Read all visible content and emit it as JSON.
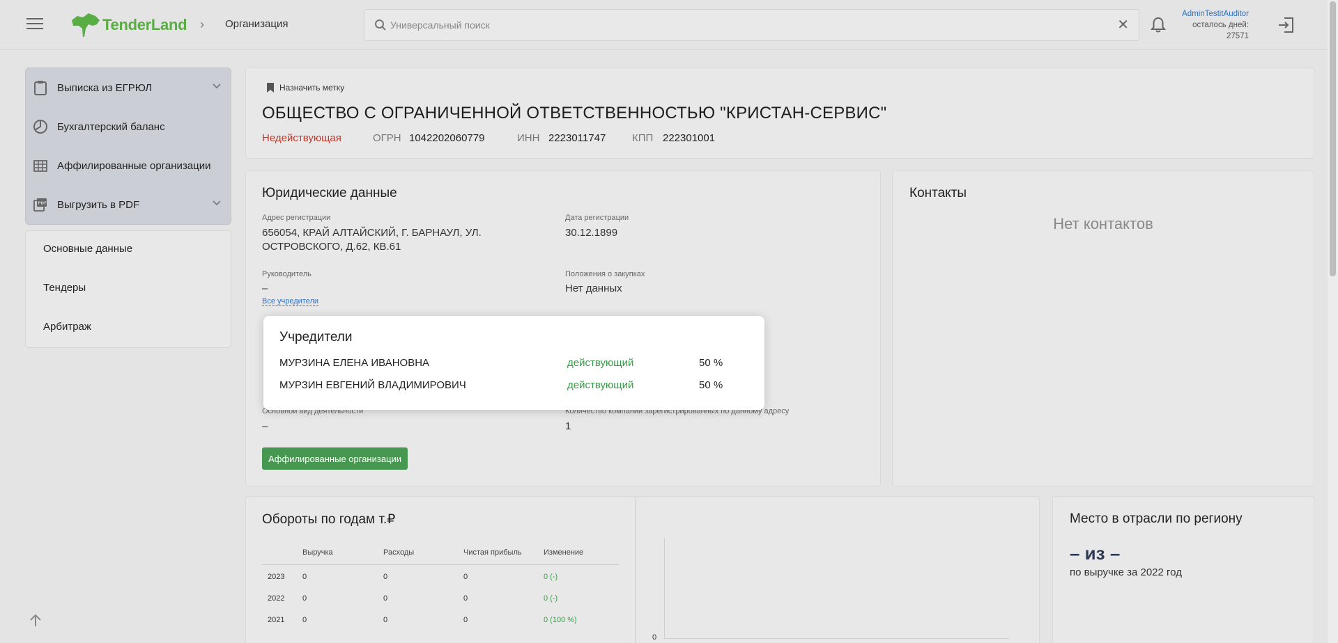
{
  "header": {
    "logo_text": "TenderLand",
    "breadcrumb_current": "Организация",
    "search_placeholder": "Универсальный поиск",
    "user_name": "AdminTestitAuditor",
    "days_label": "осталось дней:",
    "days_value": "27571"
  },
  "sidebar": {
    "actions": [
      {
        "label": "Выписка из ЕГРЮЛ",
        "icon": "clipboard-icon",
        "has_dropdown": true
      },
      {
        "label": "Бухгалтерский баланс",
        "icon": "pie-chart-icon",
        "has_dropdown": false
      },
      {
        "label": "Аффилированные организации",
        "icon": "table-icon",
        "has_dropdown": false
      },
      {
        "label": "Выгрузить в PDF",
        "icon": "pdf-icon",
        "has_dropdown": true
      }
    ],
    "nav": [
      {
        "label": "Основные данные"
      },
      {
        "label": "Тендеры"
      },
      {
        "label": "Арбитраж"
      }
    ]
  },
  "org": {
    "tag_label": "Назначить метку",
    "name": "ОБЩЕСТВО С ОГРАНИЧЕННОЙ ОТВЕТСТВЕННОСТЬЮ \"КРИСТАН-СЕРВИС\"",
    "status": "Недействующая",
    "ogrn_label": "ОГРН",
    "ogrn": "1042202060779",
    "inn_label": "ИНН",
    "inn": "2223011747",
    "kpp_label": "КПП",
    "kpp": "222301001"
  },
  "legal": {
    "title": "Юридические данные",
    "address_label": "Адрес регистрации",
    "address_line1": "656054, КРАЙ АЛТАЙСКИЙ, Г. БАРНАУЛ, УЛ.",
    "address_line2": "ОСТРОВСКОГО, Д.62, КВ.61",
    "reg_date_label": "Дата регистрации",
    "reg_date": "30.12.1899",
    "head_label": "Руководитель",
    "head_value": "–",
    "founders_link": "Все учредители",
    "purchase_label": "Положения о закупках",
    "purchase_value": "Нет данных",
    "activity_label": "Основной вид деятельности",
    "activity_value": "–",
    "companies_label": "Количество компаний зарегистрированных по данному адресу",
    "companies_value": "1",
    "affiliated_button": "Аффилированные организации"
  },
  "founders_popup": {
    "title": "Учредители",
    "rows": [
      {
        "name": "МУРЗИНА ЕЛЕНА ИВАНОВНА",
        "status": "действующий",
        "share": "50 %"
      },
      {
        "name": "МУРЗИН ЕВГЕНИЙ ВЛАДИМИРОВИЧ",
        "status": "действующий",
        "share": "50 %"
      }
    ]
  },
  "contacts": {
    "title": "Контакты",
    "empty": "Нет контактов"
  },
  "turnover": {
    "title": "Обороты по годам т.₽",
    "columns": [
      "",
      "Выручка",
      "Расходы",
      "Чистая прибыль",
      "Изменение"
    ],
    "rows": [
      {
        "year": "2023",
        "revenue": "0",
        "expenses": "0",
        "profit": "0",
        "change": "0 (-)"
      },
      {
        "year": "2022",
        "revenue": "0",
        "expenses": "0",
        "profit": "0",
        "change": "0 (-)"
      },
      {
        "year": "2021",
        "revenue": "0",
        "expenses": "0",
        "profit": "0",
        "change": "0 (100 %)"
      }
    ],
    "chart_zero_label": "0"
  },
  "region_rank": {
    "title": "Место в отрасли по региону",
    "value": "– из –",
    "subtitle": "по выручке за 2022 год"
  },
  "colors": {
    "brand_green": "#5aad45",
    "button_green": "#46974f",
    "status_red": "#c0392b",
    "status_green": "#3a9a4a",
    "link_blue": "#2f72c4"
  }
}
